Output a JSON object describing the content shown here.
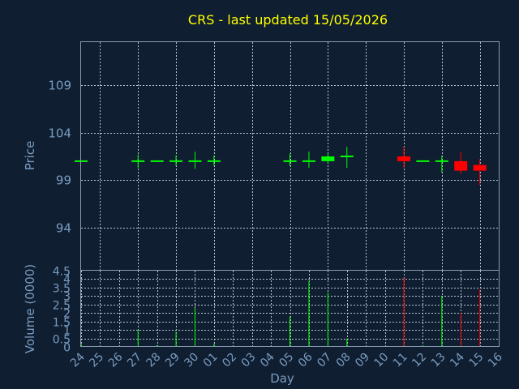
{
  "chart_data": {
    "type": "candlestick",
    "title": "CRS - last updated 15/05/2026",
    "ylabel_price": "Price",
    "ylabel_volume": "Volume (0000)",
    "xlabel": "Day",
    "price_ylim": [
      89.5,
      113.5
    ],
    "price_ticks": [
      "94",
      "99",
      "104",
      "109"
    ],
    "volume_ylim": [
      0,
      4.5
    ],
    "volume_ticks": [
      "0",
      "0.5",
      "1",
      "1.5",
      "2",
      "2.5",
      "3",
      "3.5",
      "4",
      "4.5"
    ],
    "x_labels": [
      "24",
      "25",
      "26",
      "27",
      "28",
      "29",
      "30",
      "01",
      "02",
      "03",
      "04",
      "05",
      "06",
      "07",
      "08",
      "09",
      "10",
      "11",
      "12",
      "13",
      "14",
      "15",
      "16"
    ],
    "colors": {
      "up": "#00ff00",
      "down": "#ff0000",
      "title": "#ffff00",
      "axis_text": "#7a9cc0",
      "background": "#0f1e30"
    },
    "candles": [
      {
        "day": "24",
        "open": 101,
        "high": 101,
        "low": 101,
        "close": 101,
        "volume": 0.2
      },
      {
        "day": "27",
        "open": 101,
        "high": 101.7,
        "low": 100.3,
        "close": 101,
        "volume": 1.0
      },
      {
        "day": "28",
        "open": 101,
        "high": 101,
        "low": 101,
        "close": 101,
        "volume": 0.1
      },
      {
        "day": "29",
        "open": 101,
        "high": 101.6,
        "low": 100.5,
        "close": 101,
        "volume": 0.9
      },
      {
        "day": "30",
        "open": 101,
        "high": 102,
        "low": 100.2,
        "close": 101,
        "volume": 2.3
      },
      {
        "day": "01",
        "open": 101,
        "high": 101.6,
        "low": 100.5,
        "close": 101,
        "volume": 0.2
      },
      {
        "day": "05",
        "open": 101,
        "high": 101.8,
        "low": 100.5,
        "close": 101,
        "volume": 1.8
      },
      {
        "day": "06",
        "open": 101,
        "high": 102,
        "low": 100.3,
        "close": 101,
        "volume": 3.9
      },
      {
        "day": "07",
        "open": 101,
        "high": 101.8,
        "low": 100.8,
        "close": 101.5,
        "volume": 3.2
      },
      {
        "day": "08",
        "open": 101.5,
        "high": 102.5,
        "low": 100.3,
        "close": 101.5,
        "volume": 0.5
      },
      {
        "day": "11",
        "open": 101.5,
        "high": 102.5,
        "low": 100.3,
        "close": 101,
        "volume": 4.1
      },
      {
        "day": "12",
        "open": 101,
        "high": 101,
        "low": 101,
        "close": 101,
        "volume": 0.1
      },
      {
        "day": "13",
        "open": 101,
        "high": 101.6,
        "low": 99.8,
        "close": 101,
        "volume": 3.0
      },
      {
        "day": "14",
        "open": 101,
        "high": 102,
        "low": 99.7,
        "close": 100,
        "volume": 2.0
      },
      {
        "day": "15",
        "open": 100.6,
        "high": 101.2,
        "low": 98.5,
        "close": 100,
        "volume": 3.4
      }
    ]
  }
}
